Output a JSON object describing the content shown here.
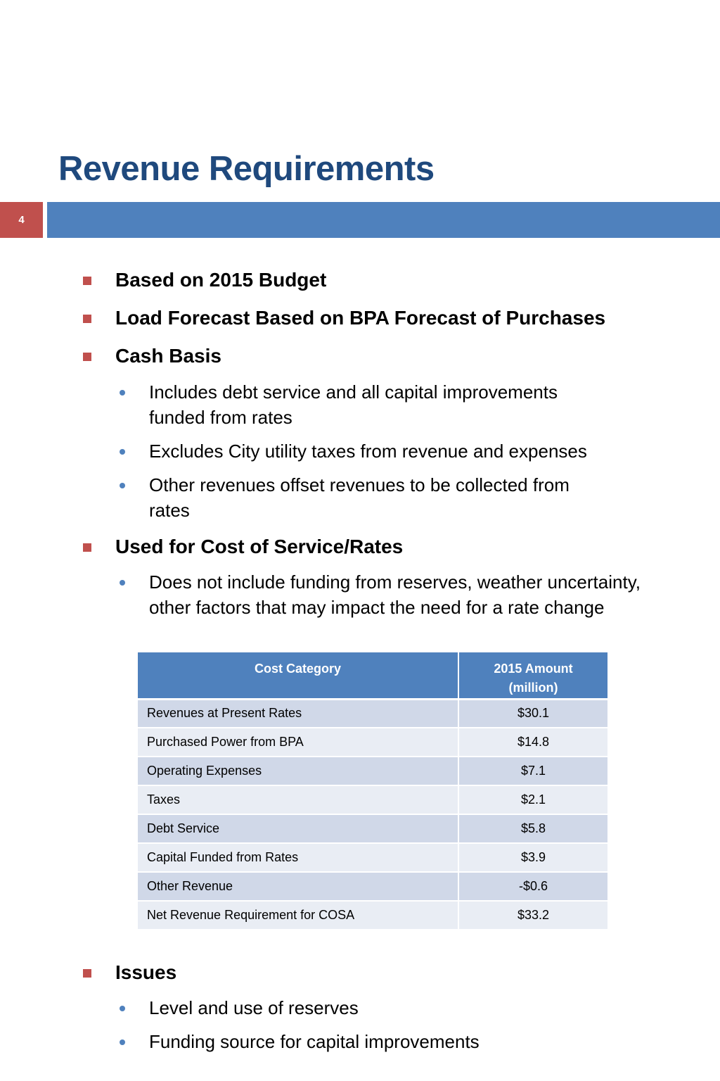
{
  "slide": {
    "title": "Revenue Requirements",
    "page_number": "4"
  },
  "bullets": {
    "b1": "Based on 2015 Budget",
    "b2": "Load Forecast Based on BPA Forecast of Purchases",
    "b3": "Cash Basis",
    "b3_sub": [
      "Includes debt service and all capital improvements funded from rates",
      "Excludes City utility taxes from revenue and expenses",
      "Other revenues offset revenues to be collected from rates"
    ],
    "b4": "Used for Cost of Service/Rates",
    "b4_sub": [
      "Does not include funding from reserves, weather uncertainty, other factors that may impact the need for a rate change"
    ],
    "b5": "Issues",
    "b5_sub": [
      "Level and use of reserves",
      "Funding source for capital improvements"
    ]
  },
  "table": {
    "headers": [
      "Cost Category",
      "2015 Amount (million)"
    ],
    "rows": [
      [
        "Revenues at Present Rates",
        "$30.1"
      ],
      [
        "Purchased Power from BPA",
        "$14.8"
      ],
      [
        "Operating Expenses",
        "$7.1"
      ],
      [
        "Taxes",
        "$2.1"
      ],
      [
        "Debt Service",
        "$5.8"
      ],
      [
        "Capital Funded from Rates",
        "$3.9"
      ],
      [
        "Other Revenue",
        "-$0.6"
      ],
      [
        "Net Revenue Requirement for COSA",
        "$33.2"
      ]
    ]
  },
  "colors": {
    "title": "#1f497d",
    "accent_blue": "#4f81bd",
    "accent_red": "#c0504d",
    "row_dark": "#d0d8e8",
    "row_light": "#e9edf4"
  }
}
